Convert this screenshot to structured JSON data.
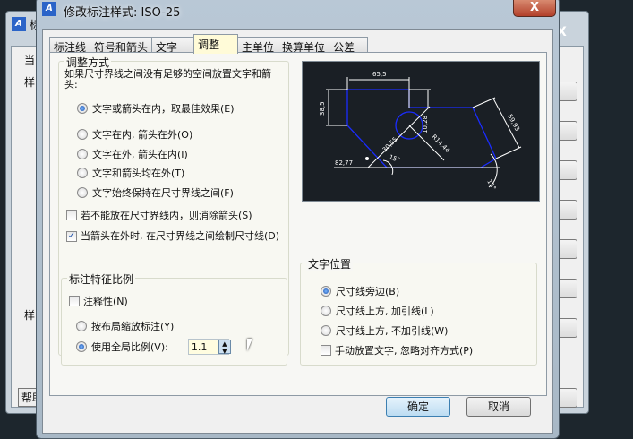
{
  "background_window": {
    "title_fragment": "标",
    "label_current": "当",
    "label_styles": "样",
    "label_style2": "样",
    "help_button": "帮助",
    "close_label": "X"
  },
  "dialog": {
    "title": "修改标注样式: ISO-25",
    "close_label": "X",
    "tabs": [
      {
        "label": "标注线"
      },
      {
        "label": "符号和箭头"
      },
      {
        "label": "文字"
      },
      {
        "label": "调整",
        "active": true
      },
      {
        "label": "主单位"
      },
      {
        "label": "换算单位"
      },
      {
        "label": "公差"
      }
    ],
    "fit_options": {
      "title": "调整方式",
      "description": "如果尺寸界线之间没有足够的空间放置文字和箭头:",
      "radios": [
        {
          "label": "文字或箭头在内，取最佳效果(E)",
          "checked": true
        },
        {
          "label": "文字在内, 箭头在外(O)",
          "checked": false
        },
        {
          "label": "文字在外, 箭头在内(I)",
          "checked": false
        },
        {
          "label": "文字和箭头均在外(T)",
          "checked": false
        },
        {
          "label": "文字始终保持在尺寸界线之间(F)",
          "checked": false
        }
      ],
      "suppress_arrows": {
        "label": "若不能放在尺寸界线内，则消除箭头(S)",
        "checked": false
      },
      "draw_dim_line": {
        "label": "当箭头在外时, 在尺寸界线之间绘制尺寸线(D)",
        "checked": true
      }
    },
    "preview": {
      "labels": {
        "top": "65,5",
        "left": "38,5",
        "right": "59,93",
        "radius": "R14,44",
        "small": "10,28",
        "diag": "30,55",
        "base": "82,77",
        "angle1": "15°",
        "angle2": "15°"
      }
    },
    "scale": {
      "title": "标注特征比例",
      "annotative": {
        "label": "注释性(N)",
        "checked": false
      },
      "layout_radio": {
        "label": "按布局缩放标注(Y)",
        "checked": false
      },
      "global_radio": {
        "label": "使用全局比例(V):",
        "checked": true
      },
      "global_value": "1.1"
    },
    "text_placement": {
      "title": "文字位置",
      "radios": [
        {
          "label": "尺寸线旁边(B)",
          "checked": true
        },
        {
          "label": "尺寸线上方, 加引线(L)",
          "checked": false
        },
        {
          "label": "尺寸线上方, 不加引线(W)",
          "checked": false
        }
      ],
      "manual": {
        "label": "手动放置文字, 忽略对齐方式(P)",
        "checked": false
      }
    },
    "ok_label": "确定",
    "cancel_label": "取消"
  }
}
